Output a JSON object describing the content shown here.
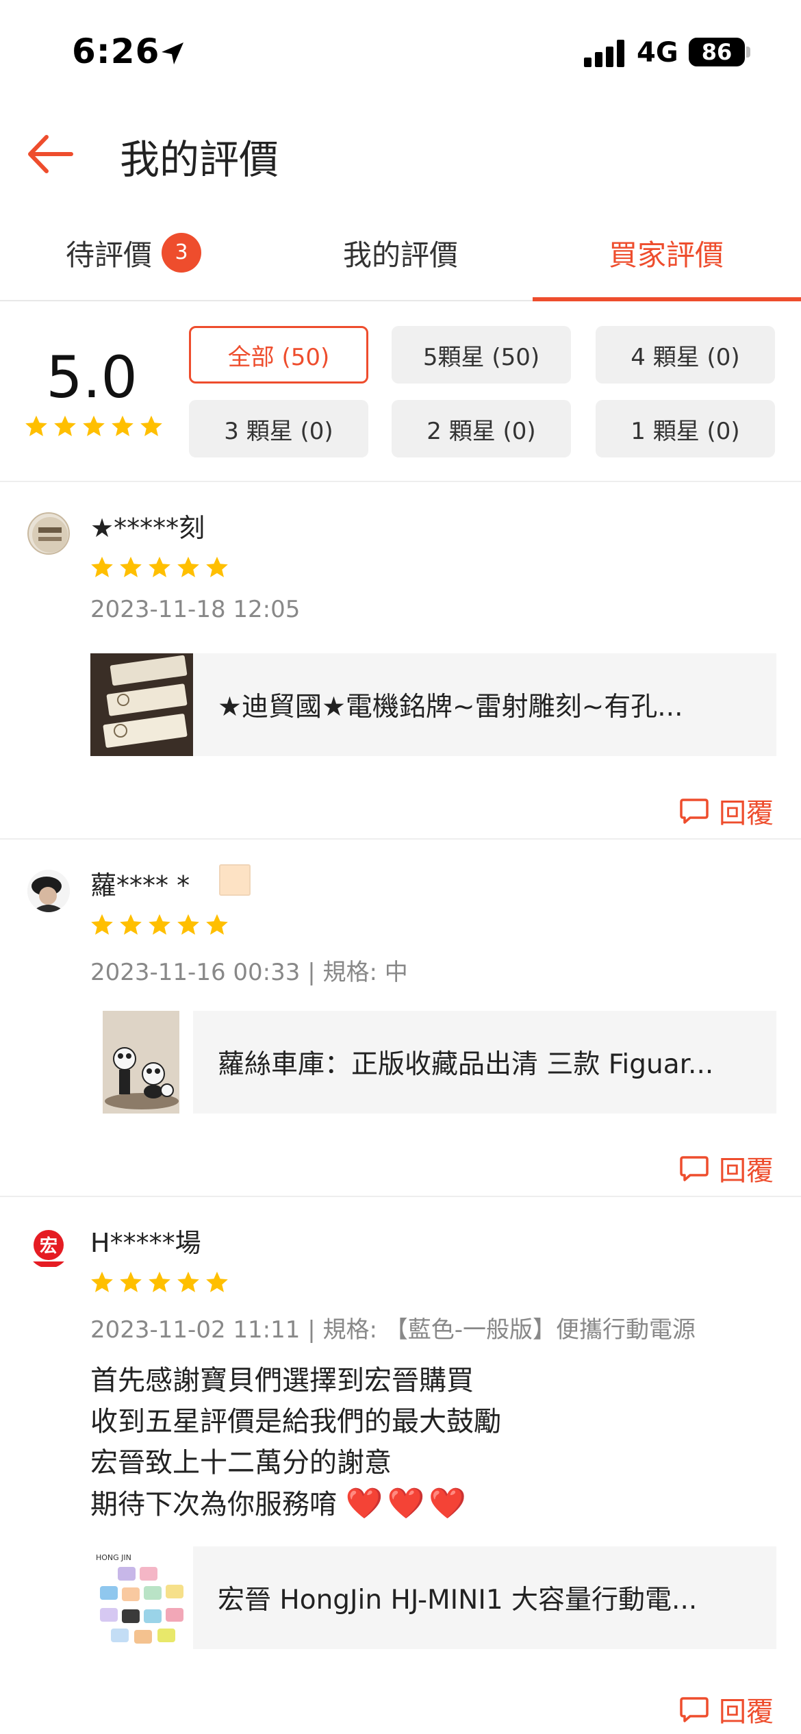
{
  "status_bar": {
    "time": "6:26",
    "network": "4G",
    "battery": "86"
  },
  "header": {
    "title": "我的評價"
  },
  "tabs": [
    {
      "label": "待評價",
      "badge": "3"
    },
    {
      "label": "我的評價"
    },
    {
      "label": "買家評價"
    }
  ],
  "summary": {
    "average": "5.0",
    "average_stars": 5,
    "filters": [
      "全部 (50)",
      "5顆星 (50)",
      "4 顆星 (0)",
      "3 顆星 (0)",
      "2 顆星 (0)",
      "1 顆星 (0)"
    ],
    "active_filter": "全部 (50)"
  },
  "reviews": [
    {
      "username": "★*****刻",
      "stars": 5,
      "meta": "2023-11-18 12:05",
      "product": "★迪貿國★電機銘牌~雷射雕刻~有孔...",
      "reply_label": "回覆"
    },
    {
      "username": "蘿**** *",
      "stars": 5,
      "meta": "2023-11-16 00:33 | 規格: 中",
      "product": "蘿絲車庫：正版收藏品出清 三款 Figuar...",
      "reply_label": "回覆"
    },
    {
      "username": "H*****場",
      "stars": 5,
      "meta": "2023-11-02 11:11 | 規格: 【藍色-一般版】便攜行動電源",
      "body": [
        "首先感謝寶貝們選擇到宏晉購買",
        "收到五星評價是給我們的最大鼓勵",
        "宏晉致上十二萬分的謝意",
        "期待下次為你服務唷"
      ],
      "hearts": "❤️❤️❤️",
      "product": "宏晉 HongJin HJ-MINI1 大容量行動電...",
      "reply_label": "回覆",
      "avatar_text": "宏",
      "thumb_text": "HONG JIN"
    }
  ],
  "colors": {
    "accent": "#ee4d2d",
    "star": "#ffbf00"
  }
}
